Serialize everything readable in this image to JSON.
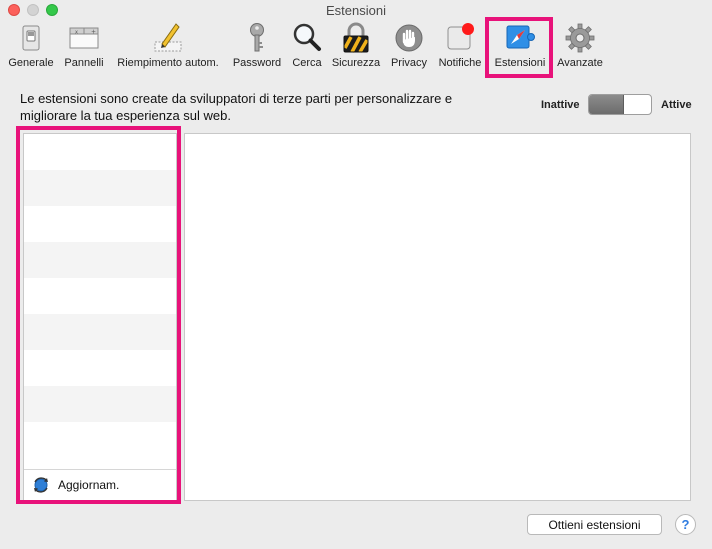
{
  "window": {
    "title": "Estensioni"
  },
  "toolbar": {
    "items": [
      {
        "label": "Generale",
        "icon": "switch-icon"
      },
      {
        "label": "Pannelli",
        "icon": "tabs-icon"
      },
      {
        "label": "Riempimento autom.",
        "icon": "pencil-form-icon"
      },
      {
        "label": "Password",
        "icon": "key-icon"
      },
      {
        "label": "Cerca",
        "icon": "magnifier-icon"
      },
      {
        "label": "Sicurezza",
        "icon": "padlock-icon"
      },
      {
        "label": "Privacy",
        "icon": "hand-icon"
      },
      {
        "label": "Notifiche",
        "icon": "notification-badge-icon"
      },
      {
        "label": "Estensioni",
        "icon": "compass-puzzle-icon"
      },
      {
        "label": "Avanzate",
        "icon": "gear-icon"
      }
    ],
    "selected": "Estensioni"
  },
  "description": "Le estensioni sono create da sviluppatori di terze parti per personalizzare e migliorare la tua esperienza sul web.",
  "toggle": {
    "off_label": "Inattive",
    "on_label": "Attive",
    "state": "off"
  },
  "list": {
    "updates_label": "Aggiornam."
  },
  "buttons": {
    "get_extensions": "Ottieni estensioni",
    "help": "?"
  },
  "colors": {
    "highlight": "#e8127a",
    "window_bg": "#ececec",
    "notification_badge": "#ff1a1a"
  }
}
